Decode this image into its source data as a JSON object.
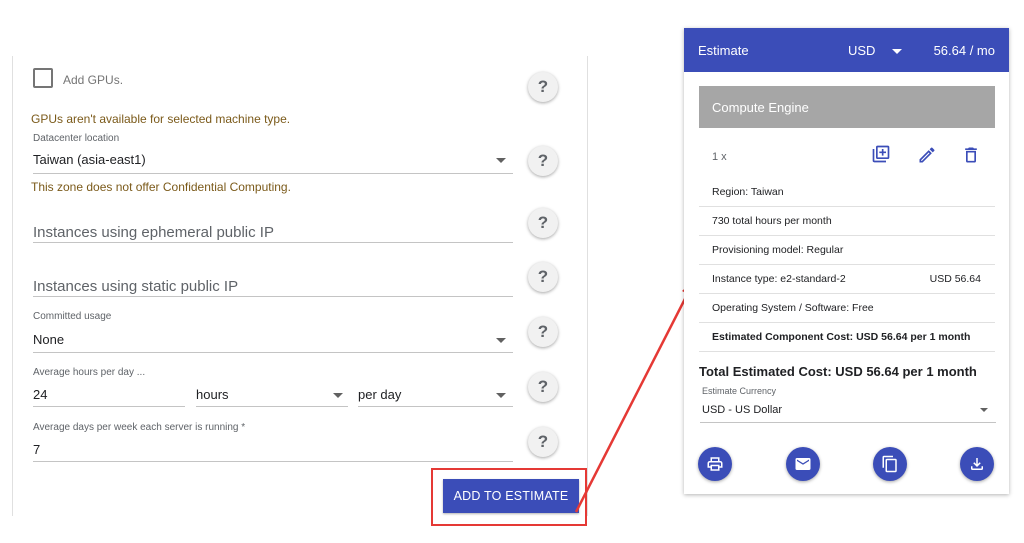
{
  "form": {
    "add_gpus_label": "Add GPUs.",
    "gpu_warning": "GPUs aren't available for selected machine type.",
    "datacenter": {
      "label": "Datacenter location",
      "value": "Taiwan (asia-east1)"
    },
    "confidential_warning": "This zone does not offer Confidential Computing.",
    "ephemeral_ip_placeholder": "Instances using ephemeral public IP",
    "static_ip_placeholder": "Instances using static public IP",
    "committed": {
      "label": "Committed usage",
      "value": "None"
    },
    "hours": {
      "label": "Average hours per day ...",
      "value": "24",
      "unit": "hours",
      "period": "per day"
    },
    "days": {
      "label": "Average days per week each server is running *",
      "value": "7"
    },
    "help_symbol": "?",
    "add_button_label": "ADD TO ESTIMATE"
  },
  "estimate": {
    "title": "Estimate",
    "currency_code": "USD",
    "monthly_total": "56.64 / mo",
    "service_name": "Compute Engine",
    "quantity": "1 x",
    "rows": [
      {
        "text": "Region: Taiwan",
        "price": ""
      },
      {
        "text": "730 total hours per month",
        "price": ""
      },
      {
        "text": "Provisioning model: Regular",
        "price": ""
      },
      {
        "text": "Instance type: e2-standard-2",
        "price": "USD 56.64"
      },
      {
        "text": "Operating System / Software: Free",
        "price": ""
      }
    ],
    "component_cost": "Estimated Component Cost: USD 56.64 per 1 month",
    "total_cost": "Total Estimated Cost: USD 56.64 per 1 month",
    "currency_label": "Estimate Currency",
    "currency_value": "USD - US Dollar"
  },
  "colors": {
    "primary": "#3b4db8",
    "highlight": "#e53935",
    "warning_text": "#7b5a1a"
  },
  "icons": [
    "copy-add-icon",
    "edit-icon",
    "delete-icon",
    "print-icon",
    "email-icon",
    "copy-icon",
    "download-icon",
    "help-icon",
    "dropdown-caret-icon"
  ]
}
